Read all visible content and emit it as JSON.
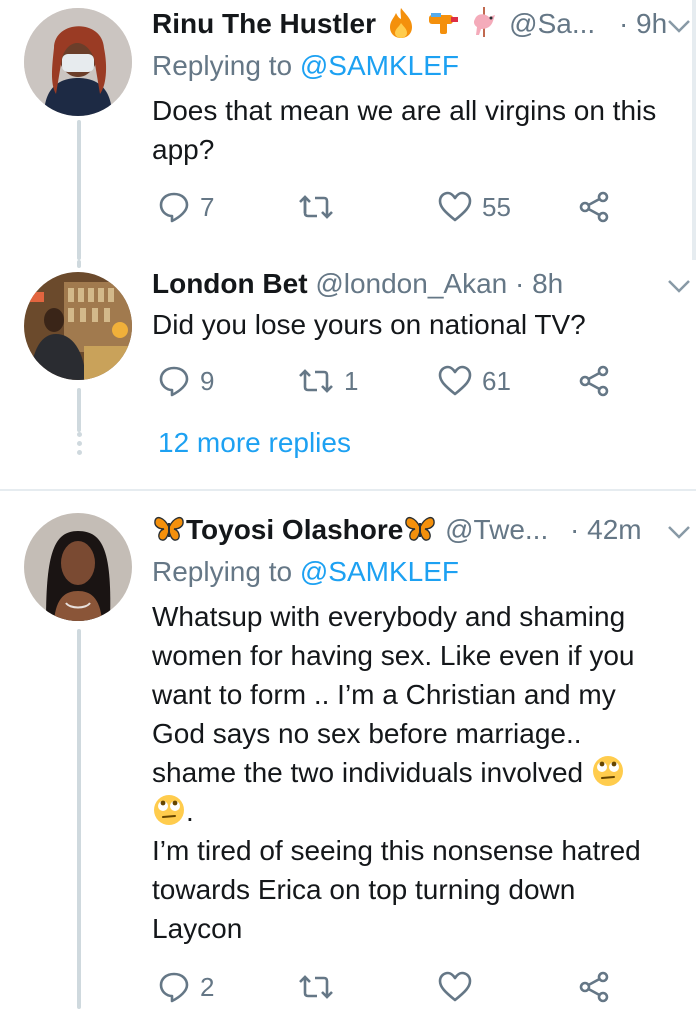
{
  "tweets": [
    {
      "name": "Rinu The Hustler",
      "name_emojis": [
        "fire-emoji",
        "water-gun-emoji",
        "carousel-horse-emoji"
      ],
      "handle": "@Sa...",
      "time": "· 9h",
      "replying_prefix": "Replying to",
      "replying_to": "@SAMKLEF",
      "text_lines": [
        "Does that mean we are all virgins on this",
        "app?"
      ],
      "replies": "7",
      "retweets": "",
      "likes": "55"
    },
    {
      "name": "London Bet",
      "handle": "@london_Akan",
      "time": "· 8h",
      "text_lines": [
        "Did you lose yours on national TV?"
      ],
      "replies": "9",
      "retweets": "1",
      "likes": "61"
    },
    {
      "name_prefix_emoji": "butterfly-emoji",
      "name": "Toyosi Olashore",
      "name_suffix_emoji": "butterfly-emoji",
      "handle": "@Twe...",
      "time": "· 42m",
      "replying_prefix": "Replying to",
      "replying_to": "@SAMKLEF",
      "text_lines": [
        "Whatsup with everybody and shaming",
        "women for having sex. Like even if you",
        "want to form .. I’m a Christian and my",
        "God says no sex before marriage..",
        "shame the two individuals involved",
        ".",
        "I’m tired of seeing this nonsense hatred",
        "towards Erica on top turning down",
        "Laycon"
      ],
      "inline_emojis": [
        "eye-roll-emoji",
        "eye-roll-emoji"
      ],
      "replies": "2",
      "retweets": "",
      "likes": ""
    }
  ],
  "more_replies": "12 more replies",
  "colors": {
    "link": "#1da1f2",
    "muted": "#657786",
    "text": "#14171a",
    "thread_line": "#cfd9de",
    "divider": "#e6ecf0"
  }
}
